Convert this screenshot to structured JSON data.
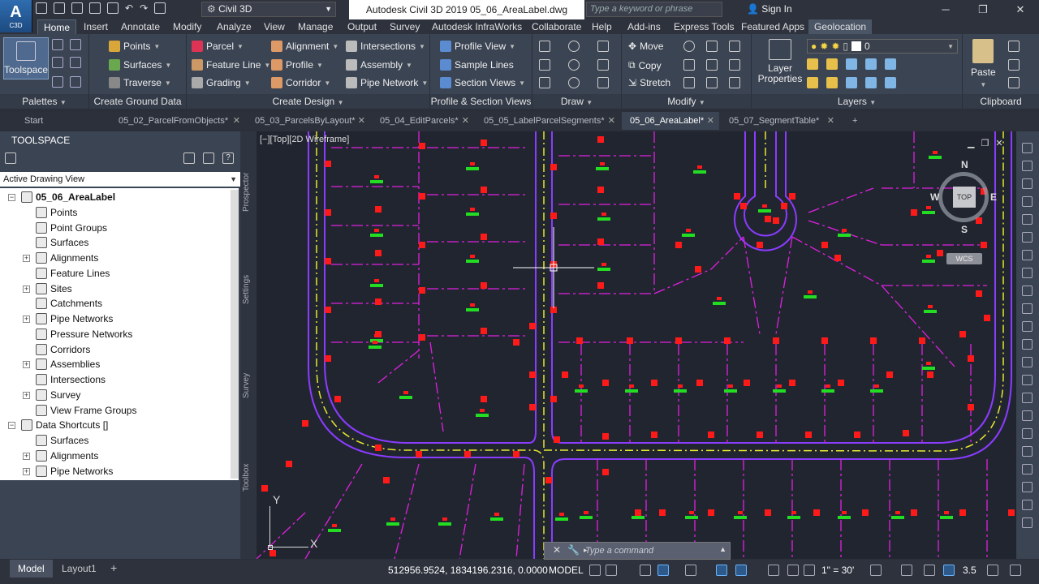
{
  "app": {
    "logo": "A",
    "logo_sub": "C3D",
    "workspace": "Civil 3D",
    "title": "Autodesk Civil 3D 2019    05_06_AreaLabel.dwg",
    "search_placeholder": "Type a keyword or phrase",
    "sign_in": "Sign In"
  },
  "ribbon_tabs": [
    "Home",
    "Insert",
    "Annotate",
    "Modify",
    "Analyze",
    "View",
    "Manage",
    "Output",
    "Survey",
    "Autodesk InfraWorks",
    "Collaborate",
    "Help",
    "Add-ins",
    "Express Tools",
    "Featured Apps",
    "Geolocation"
  ],
  "ribbon": {
    "toolspace": "Toolspace",
    "palettes": "Palettes",
    "ground": {
      "points": "Points",
      "surfaces": "Surfaces",
      "traverse": "Traverse",
      "label": "Create Ground Data"
    },
    "design": {
      "parcel": "Parcel",
      "feature_line": "Feature Line",
      "grading": "Grading",
      "alignment": "Alignment",
      "profile": "Profile",
      "corridor": "Corridor",
      "intersections": "Intersections",
      "assembly": "Assembly",
      "pipe_network": "Pipe Network",
      "label": "Create Design"
    },
    "profile": {
      "profile_view": "Profile View",
      "sample_lines": "Sample Lines",
      "section_views": "Section Views",
      "label": "Profile & Section Views"
    },
    "draw": {
      "label": "Draw"
    },
    "modify": {
      "move": "Move",
      "copy": "Copy",
      "stretch": "Stretch",
      "label": "Modify"
    },
    "layers": {
      "layer_properties": "Layer\nProperties",
      "layer_value": "0",
      "label": "Layers"
    },
    "clipboard": {
      "paste": "Paste",
      "label": "Clipboard"
    }
  },
  "doc_tabs": [
    {
      "label": "Start",
      "active": false
    },
    {
      "label": "05_02_ParcelFromObjects*",
      "active": false
    },
    {
      "label": "05_03_ParcelsByLayout*",
      "active": false
    },
    {
      "label": "05_04_EditParcels*",
      "active": false
    },
    {
      "label": "05_05_LabelParcelSegments*",
      "active": false
    },
    {
      "label": "05_06_AreaLabel*",
      "active": true
    },
    {
      "label": "05_07_SegmentTable*",
      "active": false
    }
  ],
  "toolspace": {
    "title": "TOOLSPACE",
    "view_select": "Active Drawing View",
    "vertical_tabs": [
      "Prospector",
      "Settings",
      "Survey",
      "Toolbox"
    ],
    "tree": [
      {
        "label": "05_06_AreaLabel",
        "level": 0,
        "expander": "−",
        "root": true
      },
      {
        "label": "Points",
        "level": 1,
        "expander": ""
      },
      {
        "label": "Point Groups",
        "level": 1,
        "expander": ""
      },
      {
        "label": "Surfaces",
        "level": 1,
        "expander": ""
      },
      {
        "label": "Alignments",
        "level": 1,
        "expander": "+"
      },
      {
        "label": "Feature Lines",
        "level": 1,
        "expander": ""
      },
      {
        "label": "Sites",
        "level": 1,
        "expander": "+"
      },
      {
        "label": "Catchments",
        "level": 1,
        "expander": ""
      },
      {
        "label": "Pipe Networks",
        "level": 1,
        "expander": "+"
      },
      {
        "label": "Pressure Networks",
        "level": 1,
        "expander": ""
      },
      {
        "label": "Corridors",
        "level": 1,
        "expander": ""
      },
      {
        "label": "Assemblies",
        "level": 1,
        "expander": "+"
      },
      {
        "label": "Intersections",
        "level": 1,
        "expander": ""
      },
      {
        "label": "Survey",
        "level": 1,
        "expander": "+"
      },
      {
        "label": "View Frame Groups",
        "level": 1,
        "expander": ""
      },
      {
        "label": "Data Shortcuts []",
        "level": 0,
        "expander": "−"
      },
      {
        "label": "Surfaces",
        "level": 1,
        "expander": ""
      },
      {
        "label": "Alignments",
        "level": 1,
        "expander": "+"
      },
      {
        "label": "Pipe Networks",
        "level": 1,
        "expander": "+"
      }
    ]
  },
  "drawing": {
    "view_label": "[−][Top][2D Wireframe]",
    "viewcube": {
      "top": "TOP",
      "n": "N",
      "s": "S",
      "e": "E",
      "w": "W",
      "wcs": "WCS"
    },
    "ucs": {
      "x": "X",
      "y": "Y"
    }
  },
  "command": {
    "placeholder": "Type a command"
  },
  "status": {
    "tabs": [
      "Model",
      "Layout1"
    ],
    "coords": "512956.9524, 1834196.2316, 0.0000",
    "model": "MODEL",
    "scale": "1\" = 30'",
    "zoom": "3.5"
  },
  "colors": {
    "parcel_line": "#e020e0",
    "labels": "#ff1a1a",
    "area_label": "#22dd22",
    "road_edge": "#8a3cff",
    "centerline": "#e8e830",
    "background": "#212530"
  }
}
